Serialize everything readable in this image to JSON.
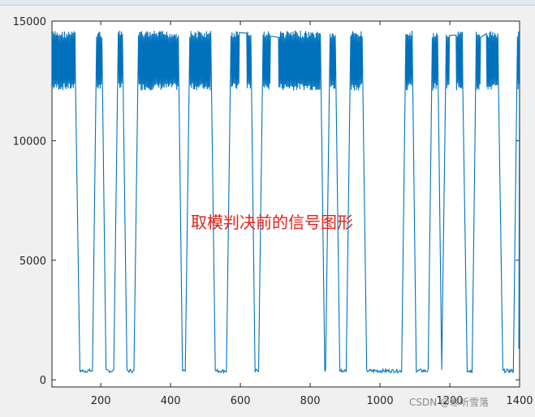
{
  "chart_data": {
    "type": "line",
    "title": "",
    "xlabel": "",
    "ylabel": "",
    "xlim": [
      60,
      1400
    ],
    "ylim": [
      -300,
      15000
    ],
    "xticks": [
      200,
      400,
      600,
      800,
      1000,
      1200,
      1400
    ],
    "yticks": [
      0,
      5000,
      10000,
      15000
    ],
    "xtick_labels": [
      "200",
      "400",
      "600",
      "800",
      "1000",
      "1200",
      "1400"
    ],
    "ytick_labels": [
      "0",
      "5000",
      "10000",
      "15000"
    ],
    "grid": false,
    "legend": "none",
    "series": [
      {
        "color": "#0072bd",
        "high_segments": [
          [
            60,
            128
          ],
          [
            188,
            203
          ],
          [
            250,
            263
          ],
          [
            308,
            422
          ],
          [
            455,
            516
          ],
          [
            573,
            598
          ],
          [
            618,
            630
          ],
          [
            665,
            686
          ],
          [
            709,
            830
          ],
          [
            857,
            873
          ],
          [
            916,
            950
          ],
          [
            1074,
            1092
          ],
          [
            1150,
            1165
          ],
          [
            1190,
            1200
          ],
          [
            1218,
            1238
          ],
          [
            1276,
            1289
          ],
          [
            1305,
            1340
          ],
          [
            1394,
            1400
          ]
        ],
        "high_level": [
          12100,
          14600
        ],
        "low_level": [
          300,
          450
        ]
      }
    ],
    "annotation": "取模判决前的信号图形"
  },
  "watermark": "CSDN @寒听雪落"
}
